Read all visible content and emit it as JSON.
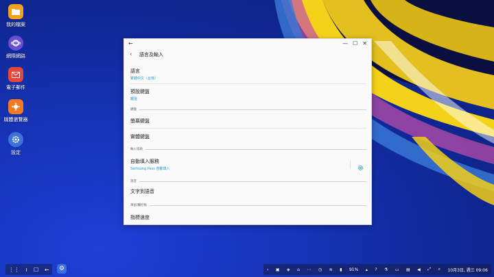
{
  "desktop": {
    "icons": [
      {
        "label": "我的檔案",
        "icon": "folder-icon",
        "color": "#f2a31b"
      },
      {
        "label": "網際網路",
        "icon": "internet-icon",
        "color": "#6a4fd1"
      },
      {
        "label": "電子郵件",
        "icon": "mail-icon",
        "color": "#e8453c"
      },
      {
        "label": "媒體瀏覽器",
        "icon": "gallery-icon",
        "color": "#f07a22"
      },
      {
        "label": "設定",
        "icon": "gear-icon",
        "color": "#3e73d8"
      }
    ]
  },
  "window": {
    "title": "語言及輸入",
    "controls": {
      "minimize": "—",
      "maximize": "☐",
      "close": "✕"
    },
    "back": "‹"
  },
  "settings": {
    "language": {
      "title": "語言",
      "subtitle": "繁體中文（台灣）"
    },
    "default_keyboard": {
      "title": "預設鍵盤",
      "subtitle": "鍵盤"
    },
    "section_keyboard": "鍵盤",
    "screen_keyboard": {
      "title": "螢幕鍵盤"
    },
    "physical_keyboard": {
      "title": "實體鍵盤"
    },
    "section_input_assist": "輸入協助",
    "autofill": {
      "title": "自動填入服務",
      "subtitle": "Samsung Pass 自動填入"
    },
    "section_voice": "語音",
    "tts": {
      "title": "文字到語音"
    },
    "section_pointer": "滑鼠/觸控板",
    "pointer_speed": {
      "title": "指標速度"
    }
  },
  "taskbar": {
    "battery": "91%",
    "datetime": "10月3日, 週三  09:06"
  },
  "colors": {
    "accent": "#2a9ac8"
  }
}
